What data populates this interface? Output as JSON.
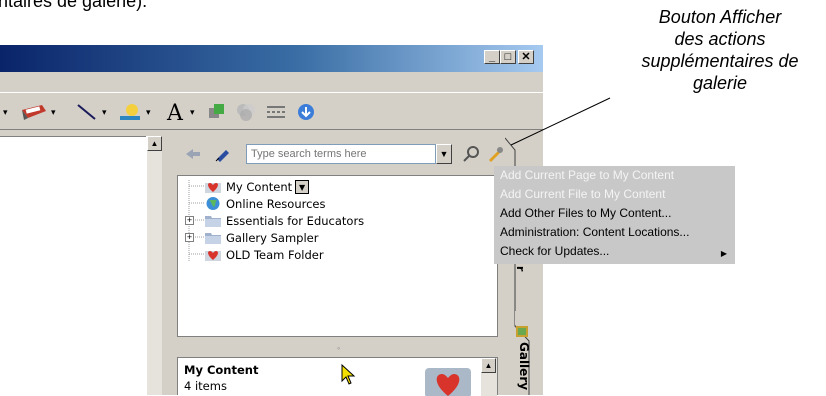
{
  "caption": {
    "top_fragment": "ntaires de galerie).",
    "callout_lines": [
      "Bouton Afficher",
      "des actions",
      "supplémentaires de",
      "galerie"
    ]
  },
  "window": {
    "buttons": [
      "minimize",
      "maximize",
      "close"
    ],
    "toolbar_icons": [
      "highlighter-icon",
      "line-icon",
      "color-icon",
      "text-icon",
      "order-icon",
      "transparency-icon",
      "align-icon",
      "gallery-icon"
    ]
  },
  "gallery": {
    "search_placeholder": "Type search terms here",
    "tree": [
      {
        "label": "My Content",
        "icon": "heart-folder-icon",
        "has_dropdown": true
      },
      {
        "label": "Online Resources",
        "icon": "globe-icon"
      },
      {
        "label": "Essentials for Educators",
        "icon": "folder-icon",
        "expandable": true
      },
      {
        "label": "Gallery Sampler",
        "icon": "folder-icon",
        "expandable": true
      },
      {
        "label": "OLD Team Folder",
        "icon": "heart-folder-icon"
      }
    ],
    "info_title": "My Content",
    "info_count": "4 items",
    "tab_label": "Gallery"
  },
  "menu": {
    "items": [
      {
        "label": "Add Current Page to My Content",
        "enabled": false
      },
      {
        "label": "Add Current File to My Content",
        "enabled": false
      },
      {
        "label": "Add Other Files to My Content...",
        "enabled": true
      },
      {
        "label": "Administration: Content Locations...",
        "enabled": true
      },
      {
        "label": "Check for Updates...",
        "enabled": true,
        "submenu": true
      }
    ]
  }
}
